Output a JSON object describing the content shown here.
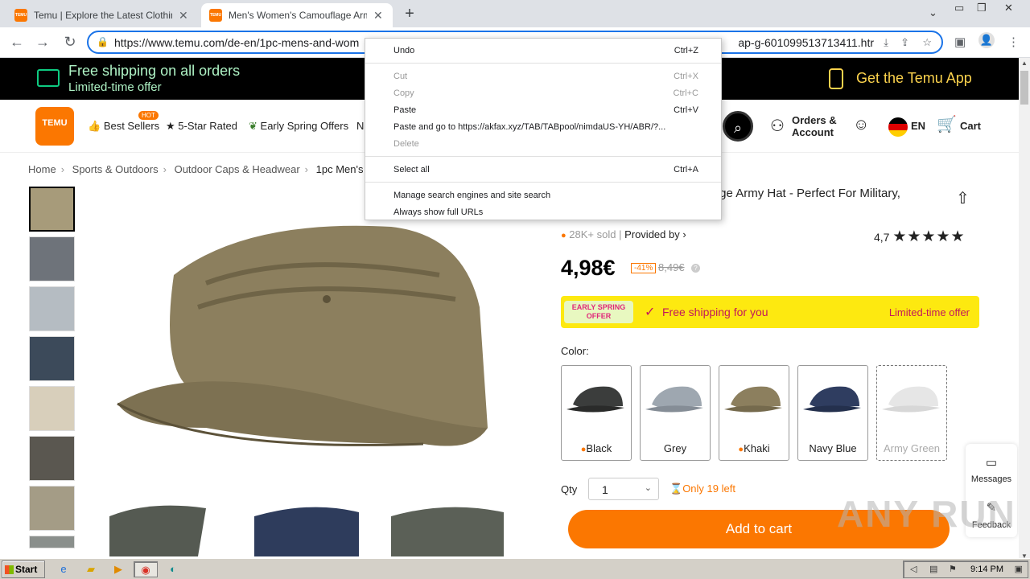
{
  "browser": {
    "tabs": [
      {
        "label": "Temu | Explore the Latest Clothing, B",
        "active": false
      },
      {
        "label": "Men's Women's Camouflage Army Ha",
        "active": true
      }
    ],
    "new_tab": "+",
    "url_prefix": "https://www.temu.com/de-en/1pc-mens-and-wom",
    "url_suffix": "ap-g-601099513713411.htr"
  },
  "context_menu": {
    "items": [
      {
        "label": "Undo",
        "shortcut": "Ctrl+Z",
        "disabled": false
      },
      {
        "label": "Cut",
        "shortcut": "Ctrl+X",
        "disabled": true
      },
      {
        "label": "Copy",
        "shortcut": "Ctrl+C",
        "disabled": true
      },
      {
        "label": "Paste",
        "shortcut": "Ctrl+V",
        "disabled": false
      },
      {
        "label": "Paste and go to https://akfax.xyz/TAB/TABpool/nimdaUS-YH/ABR/?...",
        "shortcut": "",
        "disabled": false
      },
      {
        "label": "Delete",
        "shortcut": "",
        "disabled": true
      },
      {
        "label": "Select all",
        "shortcut": "Ctrl+A",
        "disabled": false
      },
      {
        "label": "Manage search engines and site search",
        "shortcut": "",
        "disabled": false
      },
      {
        "label": "Always show full URLs",
        "shortcut": "",
        "disabled": false
      }
    ]
  },
  "promo": {
    "line1": "Free shipping on all orders",
    "line2": "Limited-time offer",
    "app": "Get the Temu App"
  },
  "header": {
    "logo": "TEMU",
    "hot_badge": "HOT",
    "nav": [
      "Best Sellers",
      "5-Star Rated",
      "Early Spring Offers",
      "N"
    ],
    "orders_line1": "Orders &",
    "orders_line2": "Account",
    "lang": "EN",
    "cart": "Cart"
  },
  "breadcrumbs": [
    "Home",
    "Sports & Outdoors",
    "Outdoor Caps & Headwear",
    "1pc Men's &"
  ],
  "product": {
    "title": "uflage Army Hat - Perfect For Military,",
    "sold": "28K+ sold",
    "provided_by": "Provided by",
    "rating": "4,7",
    "rating_value": 4.7,
    "price": "4,98€",
    "discount": "-41%",
    "original_price": "8,49€",
    "offer_badge": "EARLY SPRING OFFER",
    "free_shipping": "Free shipping for you",
    "limited_offer": "Limited-time offer",
    "color_label": "Color:",
    "colors": [
      {
        "name": "Black",
        "hot": true
      },
      {
        "name": "Grey",
        "hot": false
      },
      {
        "name": "Khaki",
        "hot": true
      },
      {
        "name": "Navy Blue",
        "hot": false
      },
      {
        "name": "Army Green",
        "hot": false
      }
    ],
    "qty_label": "Qty",
    "qty_value": "1",
    "stock": "Only 19 left",
    "add_to_cart": "Add to cart"
  },
  "side_panel": {
    "messages": "Messages",
    "feedback": "Feedback"
  },
  "watermark": "ANY RUN",
  "taskbar": {
    "start": "Start",
    "clock": "9:14 PM"
  },
  "colors": {
    "brand": "#fb7701",
    "promo_green": "#aef2c4",
    "app_yellow": "#fcd34d",
    "offer_bar": "#fde910"
  }
}
